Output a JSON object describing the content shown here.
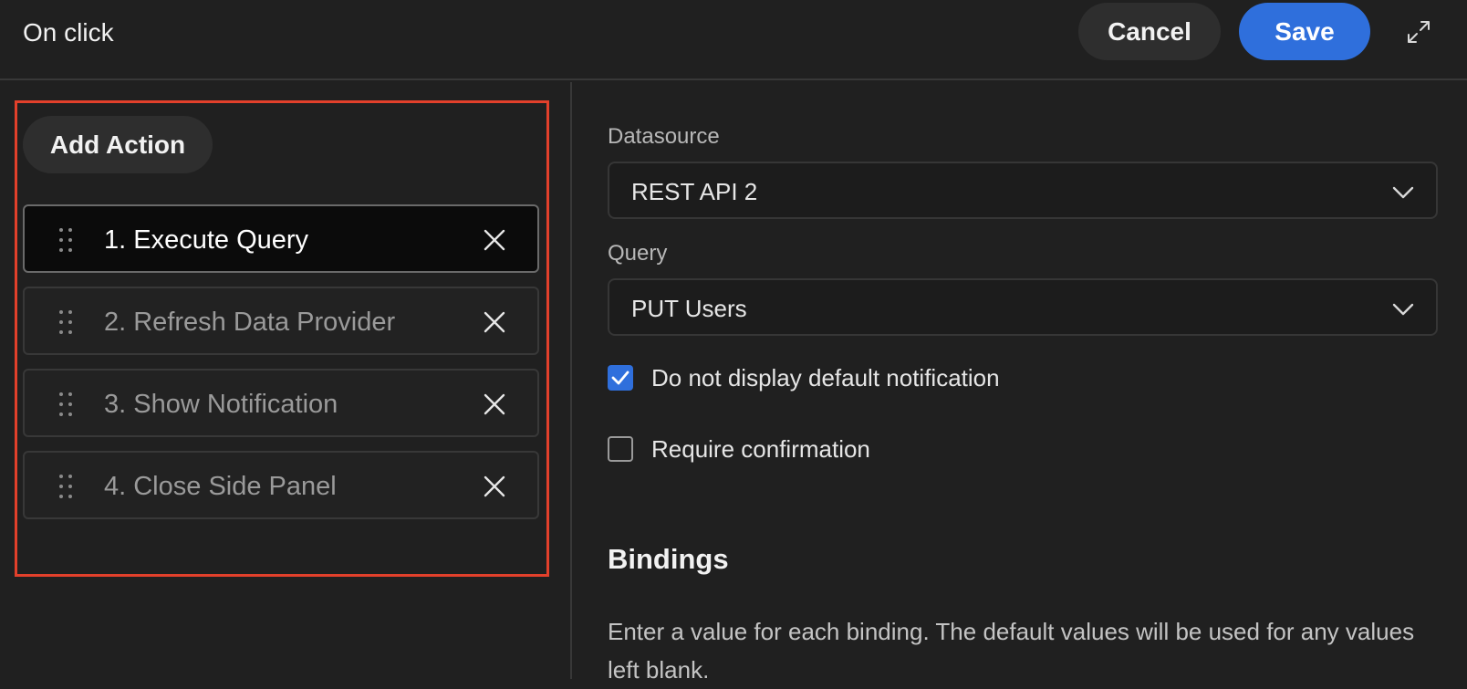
{
  "header": {
    "title": "On click",
    "cancel_label": "Cancel",
    "save_label": "Save",
    "expand_icon": "expand-icon"
  },
  "actions": {
    "add_label": "Add Action",
    "items": [
      {
        "label": "1. Execute Query",
        "active": true
      },
      {
        "label": "2. Refresh Data Provider",
        "active": false
      },
      {
        "label": "3. Show Notification",
        "active": false
      },
      {
        "label": "4. Close Side Panel",
        "active": false
      }
    ]
  },
  "form": {
    "datasource_label": "Datasource",
    "datasource_value": "REST API 2",
    "query_label": "Query",
    "query_value": "PUT Users",
    "no_notification_label": "Do not display default notification",
    "no_notification_checked": true,
    "require_confirmation_label": "Require confirmation",
    "require_confirmation_checked": false
  },
  "bindings": {
    "title": "Bindings",
    "description": "Enter a value for each binding. The default values will be used for any values left blank."
  },
  "colors": {
    "background": "#202020",
    "accent": "#2f6fdc",
    "highlight_border": "#e2402b"
  }
}
